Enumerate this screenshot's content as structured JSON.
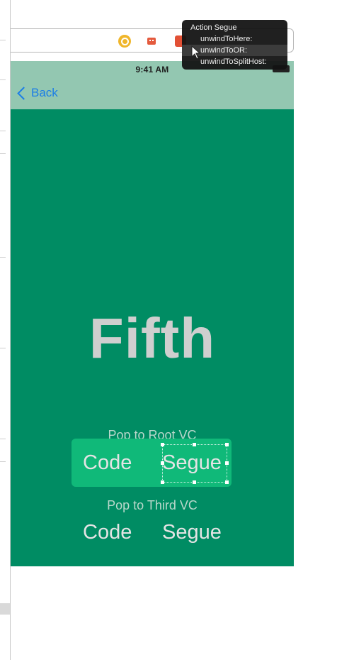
{
  "status_bar": {
    "time": "9:41 AM"
  },
  "nav": {
    "back_label": "Back"
  },
  "screen": {
    "title": "Fifth",
    "pop_root_caption": "Pop to Root VC",
    "pop_root_code": "Code",
    "pop_root_segue": "Segue",
    "pop_third_caption": "Pop to Third VC",
    "pop_third_code": "Code",
    "pop_third_segue": "Segue"
  },
  "hud": {
    "title": "Action Segue",
    "items": [
      "unwindToHere:",
      "unwindToOR:",
      "unwindToSplitHost:"
    ],
    "highlighted_index": 1
  },
  "colors": {
    "view_background": "#008c63",
    "nav_background": "#93c7b1",
    "selected_button_background": "#10b979",
    "back_tint": "#1c7ee6"
  }
}
